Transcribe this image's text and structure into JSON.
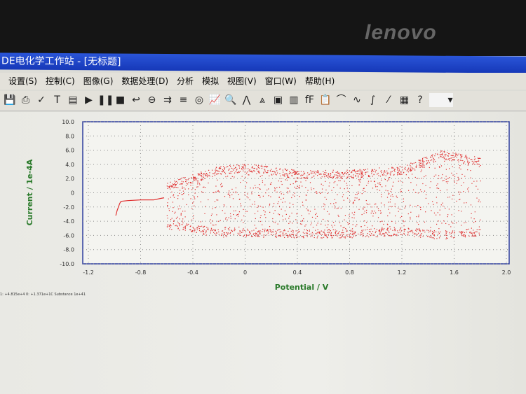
{
  "monitor_brand": "lenovo",
  "window": {
    "title": "DE电化学工作站 - [无标题]"
  },
  "menu": [
    "设置(S)",
    "控制(C)",
    "图像(G)",
    "数据处理(D)",
    "分析",
    "模拟",
    "视图(V)",
    "窗口(W)",
    "帮助(H)"
  ],
  "toolbar_icons": [
    "save-icon",
    "print-icon",
    "spell-icon",
    "text-icon",
    "panel-icon",
    "play-icon",
    "pause-icon",
    "stop-icon",
    "undo-icon",
    "cursor-icon",
    "align-icon",
    "baseline-icon",
    "target-icon",
    "graph-icon",
    "zoom-icon",
    "peak-icon",
    "peak-def-icon",
    "device-icon",
    "color-icon",
    "font-icon",
    "clipboard-icon",
    "smooth-icon",
    "wave-icon",
    "integrate-icon",
    "derivative-icon",
    "table-icon",
    "help-icon",
    "dropdown"
  ],
  "status_text": "1: +4.815e+4  0: +1.371e+1C  Substance 1e+41",
  "chart_data": {
    "type": "scatter",
    "xlabel": "Potential / V",
    "ylabel": "Current / 1e-4A",
    "xlim": [
      -1.2,
      2.0
    ],
    "ylim": [
      -10.0,
      10.0
    ],
    "xticks": [
      "-1.2",
      "-0.8",
      "-0.4",
      "0",
      "0.4",
      "0.8",
      "1.2",
      "1.6",
      "2.0"
    ],
    "yticks": [
      "10.0",
      "8.0",
      "6.0",
      "4.0",
      "2.0",
      "0",
      "-2.0",
      "-4.0",
      "-6.0",
      "-8.0",
      "-10.0"
    ],
    "grid": true,
    "color": "#e03030",
    "trace": {
      "x": [
        -0.99,
        -0.98,
        -0.96,
        -0.95,
        -0.9,
        -0.8,
        -0.7,
        -0.65,
        -0.62
      ],
      "y": [
        -3.2,
        -2.5,
        -1.5,
        -1.2,
        -1.1,
        -1.0,
        -1.0,
        -0.8,
        -0.7
      ]
    },
    "noise_band": {
      "x": [
        -0.6,
        -0.2,
        0.0,
        0.4,
        0.8,
        1.2,
        1.5,
        1.8
      ],
      "upper": [
        1.5,
        3.8,
        4.2,
        3.2,
        3.3,
        3.8,
        6.0,
        5.0
      ],
      "lower": [
        -5.0,
        -6.2,
        -6.2,
        -6.3,
        -6.3,
        -6.0,
        -6.5,
        -6.0
      ]
    }
  }
}
